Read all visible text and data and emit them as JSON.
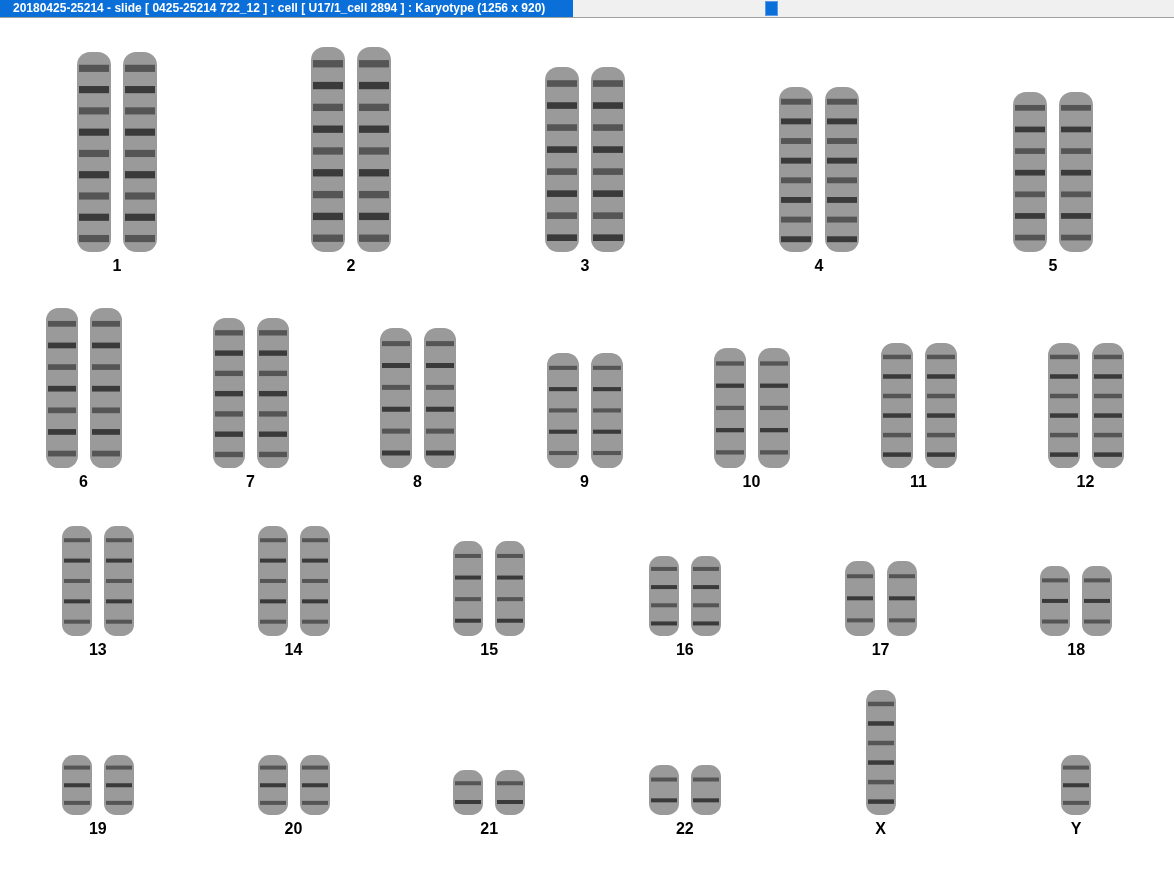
{
  "window": {
    "title": "20180425-25214 - slide [ 0425-25214 722_12 ] : cell [ U17/1_cell 2894 ] : Karyotype  (1256 x 920)"
  },
  "karyotype": {
    "rows": [
      [
        {
          "label": "1",
          "kind": "pair"
        },
        {
          "label": "2",
          "kind": "pair"
        },
        {
          "label": "3",
          "kind": "pair"
        },
        {
          "label": "4",
          "kind": "pair"
        },
        {
          "label": "5",
          "kind": "pair"
        }
      ],
      [
        {
          "label": "6",
          "kind": "pair"
        },
        {
          "label": "7",
          "kind": "pair"
        },
        {
          "label": "8",
          "kind": "pair"
        },
        {
          "label": "9",
          "kind": "pair"
        },
        {
          "label": "10",
          "kind": "pair"
        },
        {
          "label": "11",
          "kind": "pair"
        },
        {
          "label": "12",
          "kind": "pair"
        }
      ],
      [
        {
          "label": "13",
          "kind": "pair"
        },
        {
          "label": "14",
          "kind": "pair"
        },
        {
          "label": "15",
          "kind": "pair"
        },
        {
          "label": "16",
          "kind": "pair"
        },
        {
          "label": "17",
          "kind": "pair"
        },
        {
          "label": "18",
          "kind": "pair"
        }
      ],
      [
        {
          "label": "19",
          "kind": "pair"
        },
        {
          "label": "20",
          "kind": "pair"
        },
        {
          "label": "21",
          "kind": "pair"
        },
        {
          "label": "22",
          "kind": "pair"
        },
        {
          "label": "X",
          "kind": "single"
        },
        {
          "label": "Y",
          "kind": "single"
        }
      ]
    ]
  }
}
